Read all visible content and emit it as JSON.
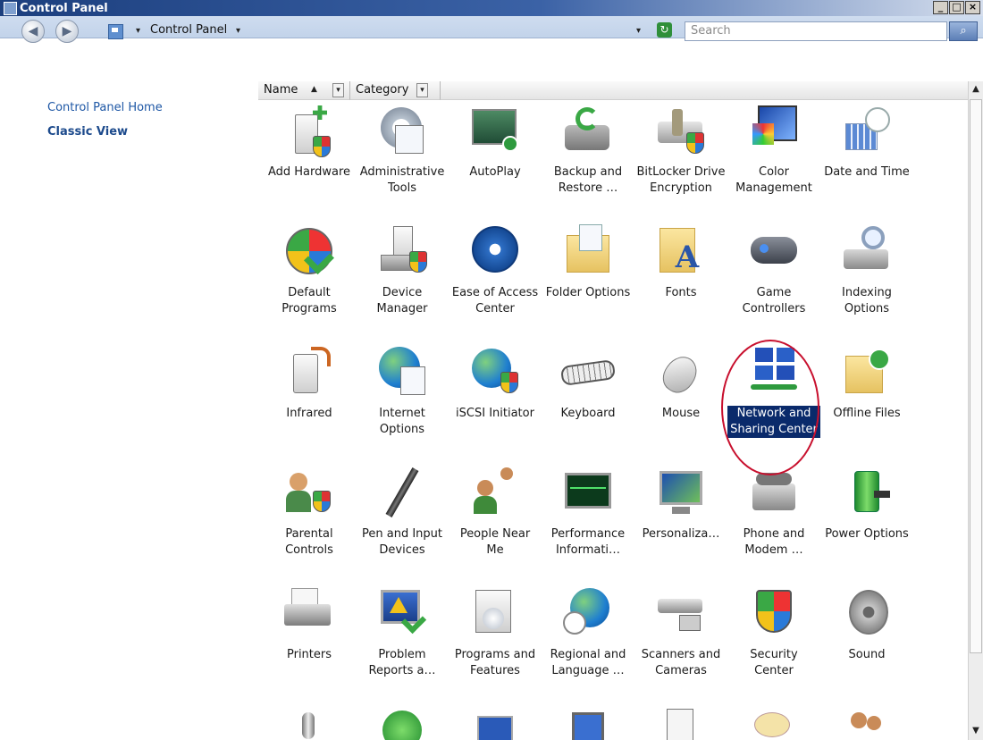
{
  "window": {
    "title": "Control Panel"
  },
  "title_controls": [
    "_",
    "□",
    "×"
  ],
  "address": {
    "crumb": "Control Panel",
    "arrow": "▾",
    "back": "◀",
    "forward": "▶",
    "refresh": "↻",
    "search_placeholder": "Search",
    "search_button": "⌕"
  },
  "left_pane": {
    "home_link": "Control Panel Home",
    "classic_view": "Classic View"
  },
  "columns": {
    "name": "Name",
    "category": "Category",
    "name_sort": "▲",
    "dropdown": "▾"
  },
  "scroll": {
    "up": "▲",
    "down": "▼"
  },
  "items": [
    {
      "label": "Add Hardware",
      "icon": "hardware-icon"
    },
    {
      "label": "Administrative Tools",
      "icon": "admin-tools-icon"
    },
    {
      "label": "AutoPlay",
      "icon": "autoplay-icon"
    },
    {
      "label": "Backup and Restore …",
      "icon": "backup-icon"
    },
    {
      "label": "BitLocker Drive Encryption",
      "icon": "bitlocker-icon"
    },
    {
      "label": "Color Management",
      "icon": "color-icon"
    },
    {
      "label": "Date and Time",
      "icon": "clock-icon"
    },
    {
      "label": "Default Programs",
      "icon": "default-programs-icon"
    },
    {
      "label": "Device Manager",
      "icon": "device-manager-icon"
    },
    {
      "label": "Ease of Access Center",
      "icon": "ease-of-access-icon"
    },
    {
      "label": "Folder Options",
      "icon": "folder-options-icon"
    },
    {
      "label": "Fonts",
      "icon": "fonts-icon"
    },
    {
      "label": "Game Controllers",
      "icon": "gamepad-icon"
    },
    {
      "label": "Indexing Options",
      "icon": "indexing-icon"
    },
    {
      "label": "Infrared",
      "icon": "infrared-icon"
    },
    {
      "label": "Internet Options",
      "icon": "internet-options-icon"
    },
    {
      "label": "iSCSI Initiator",
      "icon": "iscsi-icon"
    },
    {
      "label": "Keyboard",
      "icon": "keyboard-icon"
    },
    {
      "label": "Mouse",
      "icon": "mouse-icon"
    },
    {
      "label": "Network and Sharing Center",
      "icon": "network-icon"
    },
    {
      "label": "Offline Files",
      "icon": "offline-files-icon"
    },
    {
      "label": "Parental Controls",
      "icon": "parental-icon"
    },
    {
      "label": "Pen and Input Devices",
      "icon": "pen-icon"
    },
    {
      "label": "People Near Me",
      "icon": "people-icon"
    },
    {
      "label": "Performance Informati…",
      "icon": "performance-icon"
    },
    {
      "label": "Personaliza…",
      "icon": "personalization-icon"
    },
    {
      "label": "Phone and Modem …",
      "icon": "phone-icon"
    },
    {
      "label": "Power Options",
      "icon": "power-icon"
    },
    {
      "label": "Printers",
      "icon": "printer-icon"
    },
    {
      "label": "Problem Reports a…",
      "icon": "problem-reports-icon"
    },
    {
      "label": "Programs and Features",
      "icon": "programs-icon"
    },
    {
      "label": "Regional and Language …",
      "icon": "regional-icon"
    },
    {
      "label": "Scanners and Cameras",
      "icon": "scanner-icon"
    },
    {
      "label": "Security Center",
      "icon": "security-icon"
    },
    {
      "label": "Sound",
      "icon": "sound-icon"
    }
  ],
  "partial_items": [
    {
      "icon": "microphone-icon"
    },
    {
      "icon": "sync-icon"
    },
    {
      "icon": "tasks-icon"
    },
    {
      "icon": "tablet-icon"
    },
    {
      "icon": "document-icon"
    },
    {
      "icon": "chat-icon"
    },
    {
      "icon": "users-icon"
    }
  ],
  "selected_item": "Network and Sharing Center",
  "colors": {
    "title_bar": "#1c3f7e",
    "link": "#1e57a5",
    "selection": "#0a2a6b",
    "annotation": "#c8102e"
  }
}
